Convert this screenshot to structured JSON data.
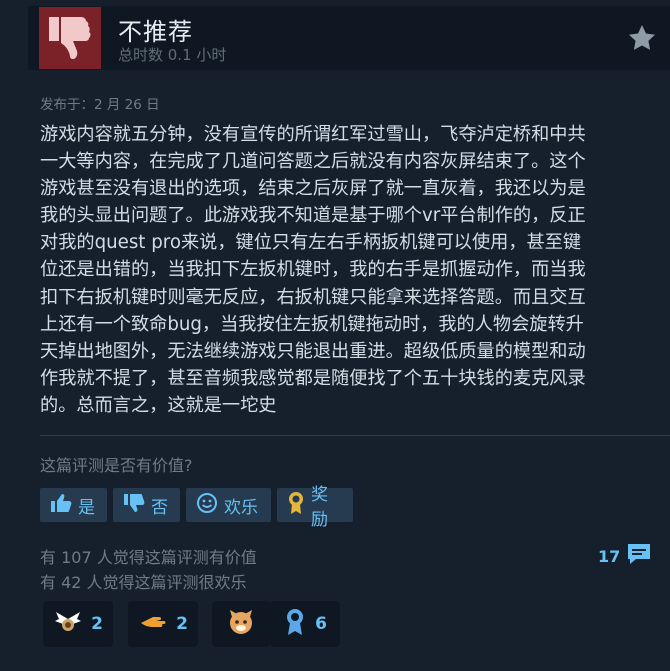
{
  "review": {
    "recommendation": "不推荐",
    "hours": "总时数 0.1 小时",
    "posted": "发布于：2 月 26 日",
    "text": "游戏内容就五分钟，没有宣传的所谓红军过雪山，飞夺泸定桥和中共\n一大等内容，在完成了几道问答题之后就没有内容灰屏结束了。这个\n游戏甚至没有退出的选项，结束之后灰屏了就一直灰着，我还以为是\n我的头显出问题了。此游戏我不知道是基于哪个vr平台制作的，反正\n对我的quest pro来说，键位只有左右手柄扳机键可以使用，甚至键\n位还是出错的，当我扣下左扳机键时，我的右手是抓握动作，而当我\n扣下右扳机键时则毫无反应，右扳机键只能拿来选择答题。而且交互\n上还有一个致命bug，当我按住左扳机键拖动时，我的人物会旋转升\n天掉出地图外，无法继续游戏只能退出重进。超级低质量的模型和动\n作我就不提了，甚至音频我感觉都是随便找了个五十块钱的麦克风录\n的。总而言之，这就是一坨史"
  },
  "feedback": {
    "question": "这篇评测是否有价值?",
    "yes": "是",
    "no": "否",
    "funny": "欢乐",
    "award": "奖励"
  },
  "stats": {
    "helpful": "有 107 人觉得这篇评测有价值",
    "funny": "有 42 人觉得这篇评测很欢乐",
    "comments": "17"
  },
  "awards": [
    {
      "icon": "winged-award-icon",
      "count": "2"
    },
    {
      "icon": "pointing-hand-award-icon",
      "count": "2"
    },
    {
      "icon": "cozy-critter-award-icon",
      "count": ""
    },
    {
      "icon": "ribbon-medal-award-icon",
      "count": "6"
    }
  ],
  "colors": {
    "background": "#1b2838",
    "not_recommended": "#7a2228",
    "accent": "#67c1f5",
    "button": "#263a50"
  }
}
